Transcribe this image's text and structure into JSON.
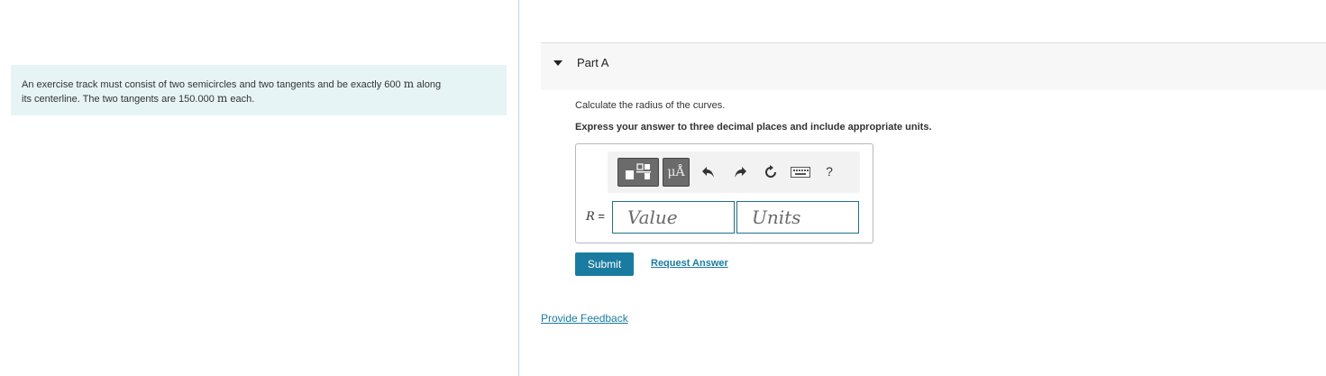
{
  "problem": {
    "text_before_1": "An exercise track must consist of two semicircles and two tangents and be exactly 600 ",
    "unit_1": "m",
    "text_after_1": " along",
    "text_line2_before": "its centerline. The two tangents are 150.000 ",
    "unit_2": "m",
    "text_after_2": " each."
  },
  "part": {
    "title": "Part A",
    "question": "Calculate the radius of the curves.",
    "instruction": "Express your answer to three decimal places and include appropriate units."
  },
  "toolbar": {
    "units_button_label": "μÅ",
    "help_label": "?"
  },
  "answer": {
    "variable": "R",
    "equals": " =",
    "value_placeholder": "Value",
    "units_placeholder": "Units"
  },
  "actions": {
    "submit_label": "Submit",
    "request_answer_label": "Request Answer",
    "feedback_label": "Provide Feedback"
  },
  "colors": {
    "problem_bg": "#e6f4f5",
    "accent": "#1a7ba0",
    "input_border": "#1f6f8a"
  }
}
